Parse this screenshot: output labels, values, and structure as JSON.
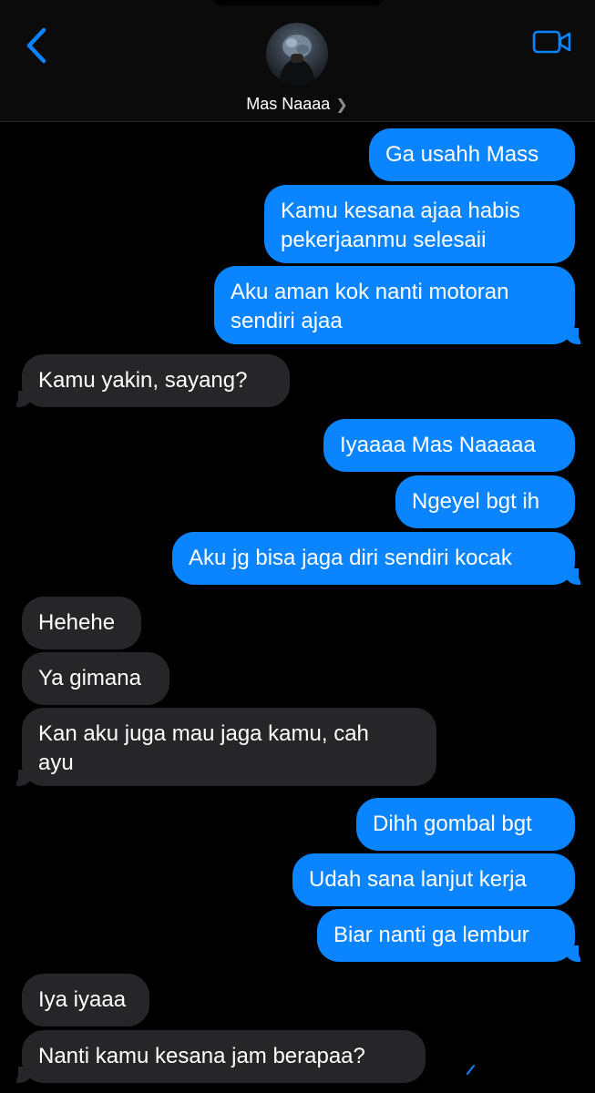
{
  "header": {
    "contact_name": "Mas Naaaa",
    "back_icon": "chevron-left-icon",
    "video_icon": "video-camera-icon",
    "accent_color": "#0a84ff"
  },
  "colors": {
    "background": "#000000",
    "sent_bubble": "#0a84ff",
    "received_bubble": "#262629"
  },
  "messages": [
    {
      "from": "me",
      "lines": [
        "Ga usahh Mass"
      ]
    },
    {
      "from": "me",
      "lines": [
        "Kamu kesana ajaa habis",
        "pekerjaanmu selesaii"
      ]
    },
    {
      "from": "me",
      "lines": [
        "Aku aman kok nanti motoran",
        "sendiri ajaa"
      ]
    },
    {
      "from": "them",
      "lines": [
        "Kamu yakin, sayang?"
      ]
    },
    {
      "from": "me",
      "lines": [
        "Iyaaaa Mas Naaaaa"
      ]
    },
    {
      "from": "me",
      "lines": [
        "Ngeyel bgt ih"
      ]
    },
    {
      "from": "me",
      "lines": [
        "Aku jg bisa jaga diri sendiri kocak"
      ]
    },
    {
      "from": "them",
      "lines": [
        "Hehehe"
      ]
    },
    {
      "from": "them",
      "lines": [
        "Ya gimana"
      ]
    },
    {
      "from": "them",
      "lines": [
        "Kan aku juga mau jaga kamu, cah",
        "ayu"
      ]
    },
    {
      "from": "me",
      "lines": [
        "Dihh gombal bgt"
      ]
    },
    {
      "from": "me",
      "lines": [
        "Udah sana lanjut kerja"
      ]
    },
    {
      "from": "me",
      "lines": [
        "Biar nanti ga lembur"
      ]
    },
    {
      "from": "them",
      "lines": [
        "Iya iyaaa"
      ]
    },
    {
      "from": "them",
      "lines": [
        "Nanti kamu kesana jam berapaa?"
      ]
    }
  ]
}
